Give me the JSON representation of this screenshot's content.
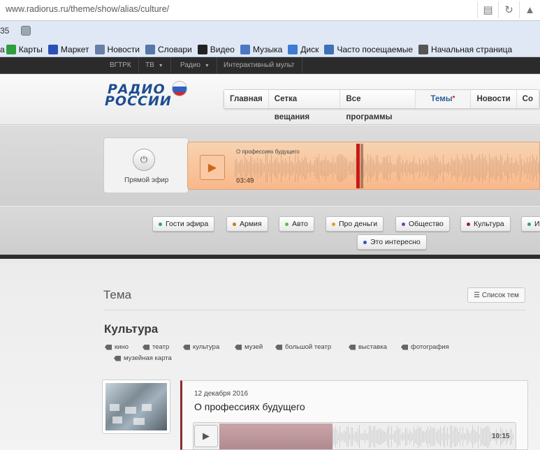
{
  "browser": {
    "url": "www.radiorus.ru/theme/show/alias/culture/",
    "reader_icon": "book-icon",
    "reload_icon": "reload-icon"
  },
  "bookmarks": {
    "counter": "35",
    "items": [
      {
        "label": "Карты",
        "icon": "maps-icon",
        "color": "#2e9e3e"
      },
      {
        "label": "Маркет",
        "icon": "market-icon",
        "color": "#2d4fb8"
      },
      {
        "label": "Новости",
        "icon": "news-icon",
        "color": "#6a7fa8"
      },
      {
        "label": "Словари",
        "icon": "dictionary-icon",
        "color": "#5577aa"
      },
      {
        "label": "Видео",
        "icon": "video-icon",
        "color": "#222222"
      },
      {
        "label": "Музыка",
        "icon": "music-icon",
        "color": "#4b78c4"
      },
      {
        "label": "Диск",
        "icon": "disk-icon",
        "color": "#3d7bd4"
      },
      {
        "label": "Часто посещаемые",
        "icon": "frequent-icon",
        "color": "#3f70b8"
      },
      {
        "label": "Начальная страница",
        "icon": "home-icon",
        "color": "#555555"
      }
    ],
    "first_fragment": "а"
  },
  "topnav": {
    "items": [
      "ВГТРК",
      "ТВ",
      "Радио",
      "Интерактивный мульт"
    ]
  },
  "logo": {
    "line1": "РАДИО",
    "line2": "РОССИИ"
  },
  "mainnav": {
    "items": [
      "Главная",
      "Сетка вещания",
      "Все программы",
      "Темы",
      "Новости",
      "Со"
    ],
    "active": "Темы"
  },
  "player": {
    "live_label": "Прямой эфир",
    "track_title": "О профессиях будущего",
    "time": "03:49",
    "progress": 0.35,
    "accent": "#f5a46b"
  },
  "themes": [
    {
      "label": "Гости эфира",
      "color": "#2aa66a"
    },
    {
      "label": "Армия",
      "color": "#c87a1e"
    },
    {
      "label": "Авто",
      "color": "#5bbd3a"
    },
    {
      "label": "Про деньги",
      "color": "#e0a020"
    },
    {
      "label": "Общество",
      "color": "#7a3fb5"
    },
    {
      "label": "Культура",
      "color": "#9a1d3a"
    },
    {
      "label": "И",
      "color": "#2aa66a"
    },
    {
      "label": "Это интересно",
      "color": "#2d56c6"
    }
  ],
  "section": {
    "heading": "Тема",
    "list_button": "☰ Список тем",
    "title": "Культура",
    "tags": [
      "кино",
      "театр",
      "культура",
      "музей",
      "большой театр",
      "выставка",
      "фотография",
      "музейная карта"
    ]
  },
  "article": {
    "date": "12 декабря 2016",
    "title": "О профессиях будущего",
    "duration": "10:15",
    "progress": 0.35
  }
}
